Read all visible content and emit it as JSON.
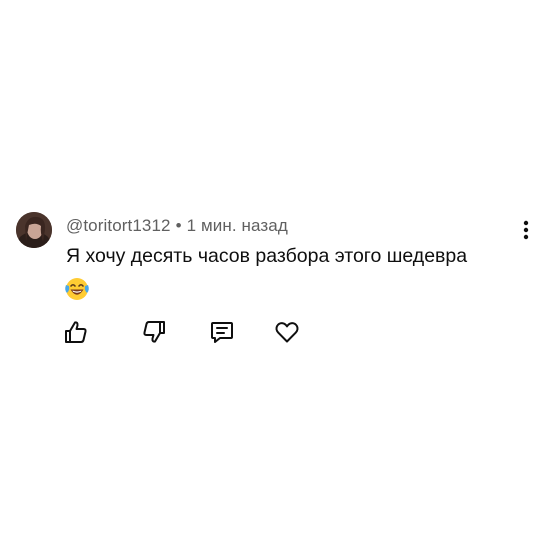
{
  "comment": {
    "author": "@toritort1312",
    "separator": "•",
    "time": "1 мин. назад",
    "text": "Я хочу десять часов разбора этого шедевра",
    "emoji": "laughing-with-tears-emoji"
  },
  "actions": {
    "like_icon": "thumbs-up-icon",
    "dislike_icon": "thumbs-down-icon",
    "reply_icon": "reply-comment-icon",
    "heart_icon": "heart-icon",
    "menu_icon": "more-vertical-icon"
  }
}
